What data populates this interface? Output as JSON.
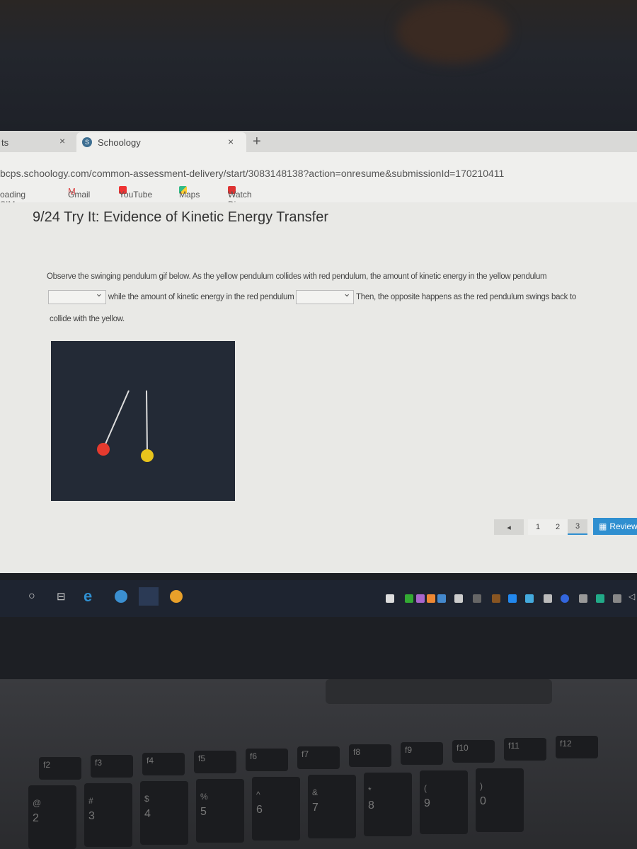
{
  "browser": {
    "tabs": [
      {
        "label": "ts"
      },
      {
        "label": "Schoology",
        "icon": "schoology-icon"
      }
    ],
    "new_tab": "+",
    "close": "×",
    "url": "bcps.schoology.com/common-assessment-delivery/start/3083148138?action=onresume&submissionId=170210411",
    "bookmarks": [
      {
        "label": "oading SIMs..."
      },
      {
        "label": "Gmail",
        "icon": "gmail-icon"
      },
      {
        "label": "YouTube",
        "icon": "youtube-icon"
      },
      {
        "label": "Maps",
        "icon": "maps-icon"
      },
      {
        "label": "Watch Disney Chan...",
        "icon": "disney-icon"
      }
    ]
  },
  "page": {
    "title": "9/24 Try It: Evidence of Kinetic Energy Transfer",
    "question": {
      "part1": "Observe the swinging pendulum gif below. As the yellow pendulum collides with red pendulum, the amount of kinetic energy in the yellow pendulum",
      "part2": "while the amount of kinetic energy in the red pendulum",
      "part3": "Then, the opposite happens as the red pendulum swings back to",
      "part4": "collide with the yellow.",
      "dropdown1": "",
      "dropdown2": ""
    },
    "pager": {
      "prev": "◂",
      "pages": [
        "1",
        "2",
        "3"
      ],
      "current": "3",
      "review": "Review"
    },
    "colors": {
      "gif_bg": "#232a36",
      "red_ball": "#e53a2e",
      "yellow_ball": "#e8c41c",
      "review": "#2f8fd0"
    }
  },
  "keyboard": {
    "fkeys": [
      "f2",
      "f3",
      "f4",
      "f5",
      "f6",
      "f7",
      "f8",
      "f9",
      "f10",
      "f11",
      "f12"
    ],
    "numbers": [
      "2",
      "3",
      "4",
      "5",
      "6",
      "7",
      "8",
      "9",
      "0"
    ],
    "symbols": [
      "@",
      "#",
      "$",
      "%",
      "^",
      "&",
      "*",
      "(",
      ")"
    ]
  }
}
